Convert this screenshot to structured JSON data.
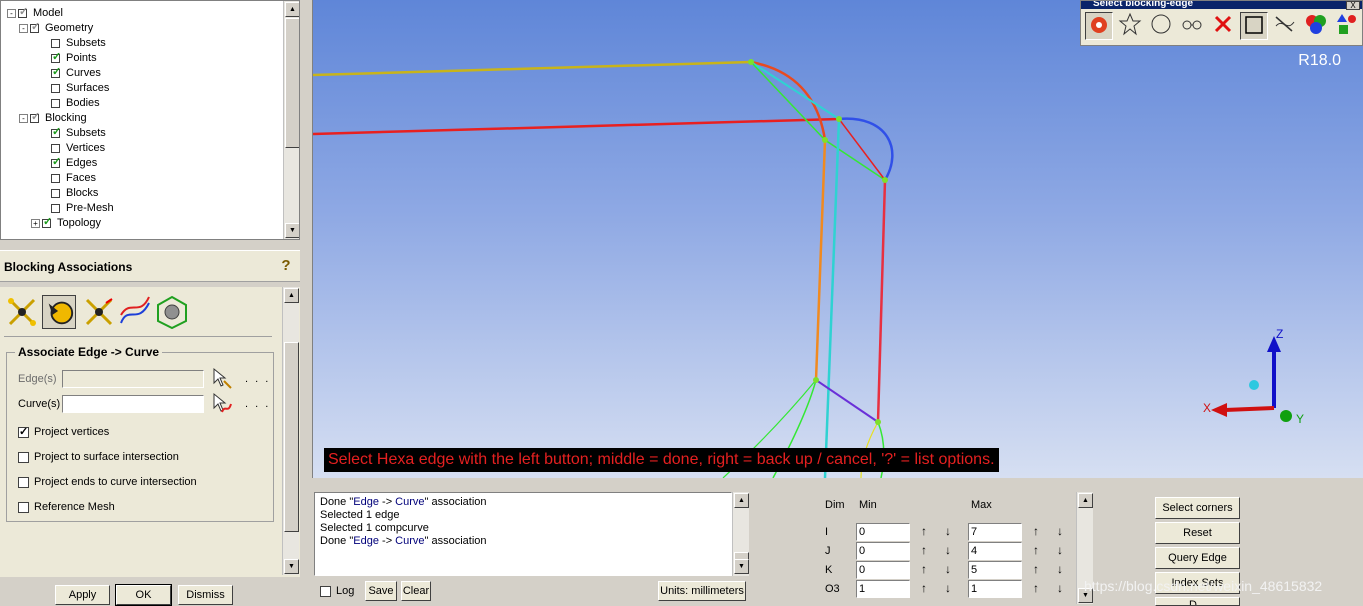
{
  "tree": {
    "items": [
      {
        "label": "Model",
        "depth": 0,
        "expander": "-",
        "check": "grey"
      },
      {
        "label": "Geometry",
        "depth": 1,
        "expander": "-",
        "check": "grey"
      },
      {
        "label": "Subsets",
        "depth": 2,
        "expander": "",
        "check": "off"
      },
      {
        "label": "Points",
        "depth": 2,
        "expander": "",
        "check": "on"
      },
      {
        "label": "Curves",
        "depth": 2,
        "expander": "",
        "check": "on"
      },
      {
        "label": "Surfaces",
        "depth": 2,
        "expander": "",
        "check": "off"
      },
      {
        "label": "Bodies",
        "depth": 2,
        "expander": "",
        "check": "off"
      },
      {
        "label": "Blocking",
        "depth": 1,
        "expander": "-",
        "check": "grey"
      },
      {
        "label": "Subsets",
        "depth": 2,
        "expander": "",
        "check": "on"
      },
      {
        "label": "Vertices",
        "depth": 2,
        "expander": "",
        "check": "off"
      },
      {
        "label": "Edges",
        "depth": 2,
        "expander": "",
        "check": "on"
      },
      {
        "label": "Faces",
        "depth": 2,
        "expander": "",
        "check": "off"
      },
      {
        "label": "Blocks",
        "depth": 2,
        "expander": "",
        "check": "off"
      },
      {
        "label": "Pre-Mesh",
        "depth": 2,
        "expander": "",
        "check": "off"
      },
      {
        "label": "Topology",
        "depth": 2,
        "expander": "+",
        "check": "on"
      }
    ]
  },
  "assoc": {
    "title": "Blocking Associations",
    "group_title": "Associate Edge -> Curve",
    "edges_label": "Edge(s)",
    "edges_value": "",
    "curves_label": "Curve(s)",
    "curves_value": "",
    "dots": ". . .",
    "options": [
      {
        "label": "Project vertices",
        "checked": true
      },
      {
        "label": "Project to surface intersection",
        "checked": false
      },
      {
        "label": "Project ends to curve intersection",
        "checked": false
      },
      {
        "label": "Reference Mesh",
        "checked": false
      }
    ],
    "apply_label": "Apply",
    "ok_label": "OK",
    "dismiss_label": "Dismiss"
  },
  "viewport": {
    "status_message": "Select Hexa edge with the left button; middle = done, right = back up / cancel, '?' = list options.",
    "version": "R18.0",
    "axis_x": "X",
    "axis_y": "Y",
    "axis_z": "Z"
  },
  "select_toolbar": {
    "title": "Select blocking-edge",
    "close_label": "X"
  },
  "messages": {
    "lines": [
      {
        "pre": "Done \"",
        "q1": "Edge",
        "mid": " -> ",
        "q2": "Curve",
        "post": "\" association"
      },
      {
        "text": "Selected 1 edge"
      },
      {
        "text": "Selected 1 compcurve"
      },
      {
        "pre": "Done \"",
        "q1": "Edge",
        "mid": " -> ",
        "q2": "Curve",
        "post": "\" association"
      }
    ],
    "log_label": "Log",
    "save_label": "Save",
    "clear_label": "Clear",
    "units_label": "Units: millimeters"
  },
  "index_control": {
    "dim_header": "Dim",
    "min_header": "Min",
    "max_header": "Max",
    "rows": [
      {
        "dim": "I",
        "min": "0",
        "max": "7"
      },
      {
        "dim": "J",
        "min": "0",
        "max": "4"
      },
      {
        "dim": "K",
        "min": "0",
        "max": "5"
      },
      {
        "dim": "O3",
        "min": "1",
        "max": "1"
      }
    ],
    "buttons": [
      "Select corners",
      "Reset",
      "Query Edge",
      "Index Sets",
      "D..."
    ]
  },
  "watermark": "https://blog.csdn.net/weixin_48615832",
  "colors": {
    "viewport_top": "#5f86d8",
    "viewport_bottom": "#d6dff2",
    "status_text": "#e52020",
    "check_green": "#1a9a1a"
  }
}
